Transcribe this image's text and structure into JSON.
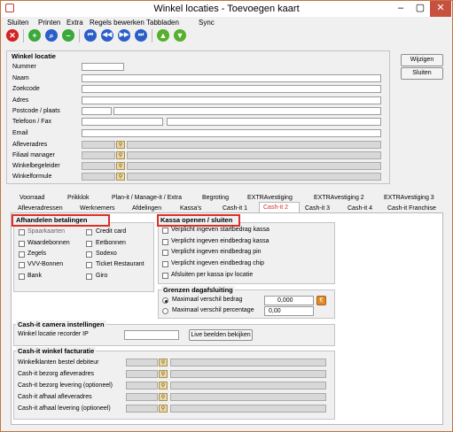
{
  "window": {
    "title": "Winkel locaties - Toevoegen kaart"
  },
  "menu": [
    "Sluiten",
    "Printen",
    "Extra",
    "Regels bewerken",
    "Tabbladen",
    "Sync"
  ],
  "toolbar_icons": [
    "close-icon",
    "add-icon",
    "search-icon",
    "remove-icon",
    "first-icon",
    "previous-icon",
    "next-icon",
    "last-icon",
    "up-icon",
    "down-icon"
  ],
  "winkel": {
    "title": "Winkel locatie",
    "fields": [
      "Nummer",
      "Naam",
      "Zoekcode",
      "Adres",
      "Postcode / plaats",
      "Telefoon / Fax",
      "Email",
      "Afleveradres",
      "Filiaal manager",
      "Winkelbegeleider",
      "Winkelformule"
    ]
  },
  "buttons": {
    "wijzigen": "Wijzigen",
    "sluiten": "Sluiten"
  },
  "tabs_row1": [
    "Voorraad",
    "Prikklok",
    "Plan-it / Manage-it / Extra",
    "Begroting",
    "EXTRAvestiging",
    "EXTRAvestiging 2",
    "EXTRAvestiging 3"
  ],
  "tabs_row2": [
    "Afleveradressen",
    "Werknemers",
    "Afdelingen",
    "Kassa's",
    "Cash-it 1",
    "Cash-it 2",
    "Cash-it 3",
    "Cash-it 4",
    "Cash-it Franchise"
  ],
  "active_tab": "Cash-it 2",
  "afhandelen": {
    "title": "Afhandelen betalingen",
    "left": [
      "Spaarkaarten",
      "Waardebonnen",
      "Zegels",
      "VVV-Bonnen",
      "Bank"
    ],
    "right": [
      "Credit card",
      "Eetbonnen",
      "Sodexo",
      "Ticket Restaurant",
      "Giro"
    ]
  },
  "kassa": {
    "title": "Kassa openen / sluiten",
    "items": [
      "Verplicht ingeven startbedrag kassa",
      "Verplicht ingeven eindbedrag kassa",
      "Verplicht ingeven eindbedrag pin",
      "Verplicht ingeven eindbedrag chip",
      "Afsluiten per kassa ipv locatie"
    ]
  },
  "grenzen": {
    "title": "Grenzen dagafsluiting",
    "bedrag_label": "Maximaal verschil bedrag",
    "bedrag_value": "0,000",
    "perc_label": "Maximaal verschil percentage",
    "perc_value": "0,00"
  },
  "camera": {
    "title": "Cash-it camera instellingen",
    "label": "Winkel locatie recorder IP",
    "button": "Live beelden bekijken"
  },
  "facturatie": {
    "title": "Cash-it winkel facturatie",
    "fields": [
      "Winkelklanten bestel debiteur",
      "Cash-it bezorg afleveradres",
      "Cash-it bezorg levering (optioneel)",
      "Cash-it afhaal afleveradres",
      "Cash-it afhaal levering (optioneel)"
    ]
  },
  "colors": {
    "accent_red": "#d9302a",
    "active_tab_text": "#d9302a"
  }
}
